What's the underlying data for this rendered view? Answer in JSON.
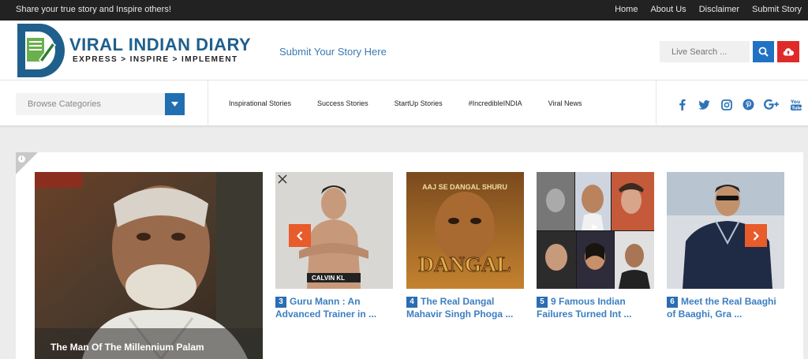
{
  "topbar": {
    "tagline": "Share your true story and Inspire others!",
    "links": [
      "Home",
      "About Us",
      "Disclaimer",
      "Submit Story"
    ]
  },
  "header": {
    "logo_title": "VIRAL INDIAN DIARY",
    "logo_subtitle": "EXPRESS > INSPIRE > IMPLEMENT",
    "submit_link": "Submit Your Story Here",
    "search_placeholder": "Live Search ...",
    "icons": [
      "search-icon",
      "cloud-upload-icon"
    ]
  },
  "nav": {
    "browse_label": "Browse Categories",
    "menu": [
      "Inspirational Stories",
      "Success Stories",
      "StartUp Stories",
      "#IncredibleINDIA",
      "Viral News"
    ],
    "social": [
      "facebook-icon",
      "twitter-icon",
      "instagram-icon",
      "pinterest-icon",
      "google-plus-icon",
      "youtube-icon"
    ]
  },
  "colors": {
    "topbar_bg": "#222222",
    "brand_blue": "#1f5f8b",
    "link_blue": "#3b7fc1",
    "button_blue": "#2272c3",
    "button_red": "#e02a2a",
    "arrow_orange": "#e85b2a"
  },
  "featured": {
    "caption": "The Man Of The Millennium Palam"
  },
  "cards": [
    {
      "num": "3",
      "line1": "Guru Mann : An",
      "line2": "Advanced Trainer in ...",
      "cover_text_1": "CALVIN KL",
      "cover_text_2": ""
    },
    {
      "num": "4",
      "line1": "The Real Dangal",
      "line2": "Mahavir Singh Phoga ...",
      "cover_text_1": "AAJ SE DANGAL SHURU",
      "cover_text_2": "DANGAL"
    },
    {
      "num": "5",
      "line1": "9 Famous Indian",
      "line2": "Failures Turned Int ...",
      "cover_text_1": "",
      "cover_text_2": ""
    },
    {
      "num": "6",
      "line1": "Meet the Real Baaghi",
      "line2": "of Baaghi, Gra ...",
      "cover_text_1": "",
      "cover_text_2": ""
    }
  ],
  "slider": {
    "icons": [
      "chevron-left-icon",
      "chevron-right-icon"
    ]
  }
}
